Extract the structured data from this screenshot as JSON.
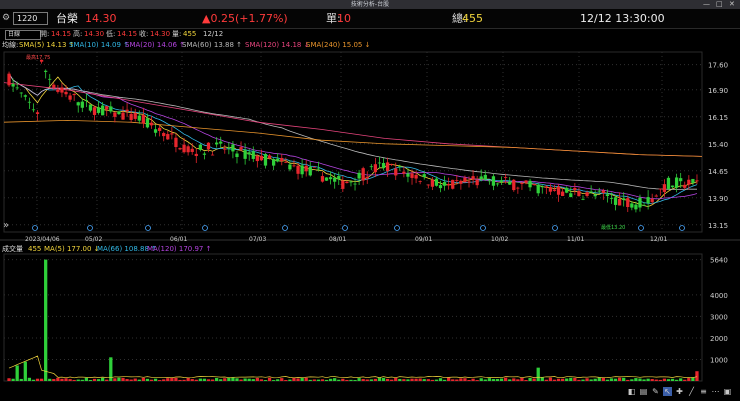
{
  "window": {
    "title": "技術分析-台股"
  },
  "quote": {
    "symbol": "1220",
    "name": "台榮",
    "price": "14.30",
    "change": "▲0.25(+1.77%)",
    "single_label": "單:",
    "single_value": "10",
    "total_label": "總:",
    "total_value": "455",
    "datetime": "12/12 13:30:00"
  },
  "info": {
    "period": "日線",
    "open_label": "開:",
    "open": "14.15",
    "high_label": "高:",
    "high": "14.30",
    "low_label": "低:",
    "low": "14.15",
    "close_label": "收:",
    "close": "14.30",
    "vol_label": "量:",
    "vol": "455",
    "date": "12/12"
  },
  "ma_legend": {
    "label": "均線:",
    "items": [
      {
        "text": "SMA(5) 14.13 ↑",
        "color": "#f2d53c"
      },
      {
        "text": "SMA(10) 14.09 ↑",
        "color": "#32b8e6"
      },
      {
        "text": "SMA(20) 14.06 ↑",
        "color": "#b444e0"
      },
      {
        "text": "SMA(60) 13.88 ↑",
        "color": "#b9b9b9"
      },
      {
        "text": "SMA(120) 14.18 ↓",
        "color": "#e8457e"
      },
      {
        "text": "SMA(240) 15.05 ↓",
        "color": "#e8942c"
      }
    ]
  },
  "vol_legend": {
    "label": "成交量",
    "value": "455",
    "items": [
      {
        "text": "MA(5) 177.00 ↓",
        "color": "#f2d53c"
      },
      {
        "text": "MA(66) 108.88 ↑",
        "color": "#32b8e6"
      },
      {
        "text": "MA(120) 170.97 ↑",
        "color": "#b444e0"
      }
    ]
  },
  "annotations": {
    "high_mark": "最高17.75",
    "low_mark": "最低13.20"
  },
  "colors": {
    "up": "#e8262d",
    "down": "#2fd03a",
    "axis_text": "#cfcfcf",
    "grid": "#303030"
  },
  "chart_data": [
    {
      "type": "candlestick",
      "title": "",
      "x_ticks": [
        "2023/04/06",
        "05/02",
        "06/01",
        "07/03",
        "08/01",
        "09/01",
        "10/02",
        "11/01",
        "12/01"
      ],
      "y_ticks": [
        17.6,
        16.9,
        16.15,
        15.4,
        14.65,
        13.9,
        13.15
      ],
      "ylim": [
        12.95,
        17.95
      ],
      "series_approx": [
        {
          "name": "SMA(120)",
          "values": [
            17.1,
            16.9,
            16.6,
            16.3,
            16.0,
            15.8,
            15.55,
            15.4,
            15.3,
            15.2,
            15.1,
            15.05
          ]
        },
        {
          "name": "SMA(240)",
          "values": [
            16.0,
            16.05,
            16.0,
            15.85,
            15.7,
            15.5,
            15.4,
            15.35,
            15.3,
            15.2,
            15.1,
            15.05
          ]
        }
      ]
    },
    {
      "type": "bar",
      "title": "",
      "y_ticks": [
        5640,
        4000,
        3000,
        2000,
        1000
      ],
      "ylim": [
        0,
        5900
      ],
      "peak_volume": 5640
    }
  ]
}
